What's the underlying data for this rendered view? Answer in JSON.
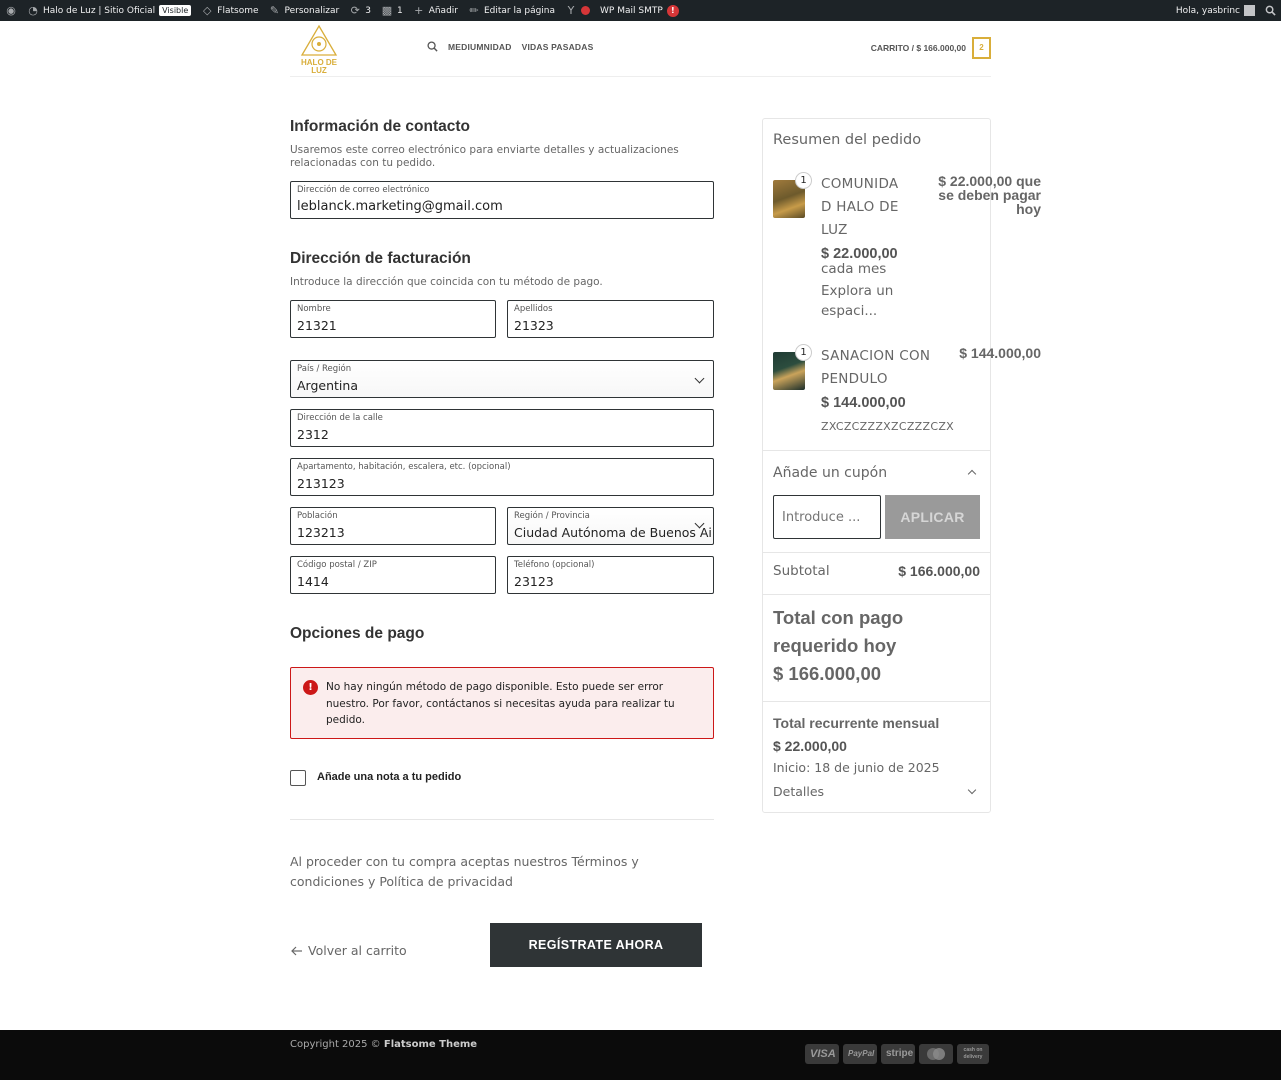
{
  "admin_bar": {
    "site_name": "Halo de Luz | Sitio Oficial",
    "visible_badge": "Visible",
    "theme": "Flatsome",
    "customize": "Personalizar",
    "updates_count": "3",
    "comments_count": "1",
    "add_new": "Añadir",
    "edit_page": "Editar la página",
    "smtp": "WP Mail SMTP",
    "smtp_alert": "!",
    "greeting": "Hola, yasbrinc"
  },
  "header": {
    "logo_text": "HALO DE LUZ",
    "nav": [
      "MEDIUMNIDAD",
      "VIDAS PASADAS"
    ],
    "cart_label": "CARRITO / $ 166.000,00",
    "cart_count": "2",
    "brand_color": "#d9ae3a"
  },
  "contact": {
    "title": "Información de contacto",
    "description": "Usaremos este correo electrónico para enviarte detalles y actualizaciones relacionadas con tu pedido.",
    "email_label": "Dirección de correo electrónico",
    "email_value": "leblanck.marketing@gmail.com"
  },
  "billing": {
    "title": "Dirección de facturación",
    "description": "Introduce la dirección que coincida con tu método de pago.",
    "first_name_label": "Nombre",
    "first_name_value": "21321",
    "last_name_label": "Apellidos",
    "last_name_value": "21323",
    "country_label": "País / Región",
    "country_value": "Argentina",
    "street_label": "Dirección de la calle",
    "street_value": "2312",
    "apartment_label": "Apartamento, habitación, escalera, etc. (opcional)",
    "apartment_value": "213123",
    "city_label": "Población",
    "city_value": "123213",
    "state_label": "Región / Provincia",
    "state_value": "Ciudad Autónoma de Buenos Aires",
    "postcode_label": "Código postal / ZIP",
    "postcode_value": "1414",
    "phone_label": "Teléfono (opcional)",
    "phone_value": "23123"
  },
  "payment": {
    "title": "Opciones de pago",
    "error": "No hay ningún método de pago disponible. Esto puede ser error nuestro. Por favor, contáctanos si necesitas ayuda para realizar tu pedido."
  },
  "note_label": "Añade una nota a tu pedido",
  "terms": "Al proceder con tu compra aceptas nuestros Términos y condiciones y Política de privacidad",
  "back_label": "Volver al carrito",
  "submit_label": "REGÍSTRATE AHORA",
  "summary": {
    "title": "Resumen del pedido",
    "items": [
      {
        "qty": "1",
        "name_lines": [
          "COMUNIDA",
          "D HALO DE",
          "LUZ"
        ],
        "price": "$ 22.000,00",
        "period": "cada mes",
        "desc_lines": [
          "Explora un",
          "espaci..."
        ],
        "total_lines": [
          "$ 22.000,00 que",
          "se deben pagar",
          "hoy"
        ]
      },
      {
        "qty": "1",
        "name_lines": [
          "SANACION CON",
          "PENDULO"
        ],
        "price": "$ 144.000,00",
        "desc": "ZXCZCZZZXZCZZZCZX",
        "total": "$ 144.000,00"
      }
    ],
    "coupon_title": "Añade un cupón",
    "coupon_placeholder": "Introduce ...",
    "coupon_button": "APLICAR",
    "subtotal_label": "Subtotal",
    "subtotal_value": "$ 166.000,00",
    "total_lines": [
      "Total con pago",
      "requerido hoy",
      "$ 166.000,00"
    ],
    "recurring_title": "Total recurrente mensual",
    "recurring_value": "$ 22.000,00",
    "recurring_start": "Inicio: 18 de junio de 2025",
    "details_label": "Detalles"
  },
  "footer": {
    "copyright_prefix": "Copyright 2025 ©",
    "copyright_brand": "Flatsome Theme",
    "payment_icons": [
      "VISA",
      "PayPal",
      "stripe",
      "mastercard",
      "cash on delivery"
    ]
  }
}
